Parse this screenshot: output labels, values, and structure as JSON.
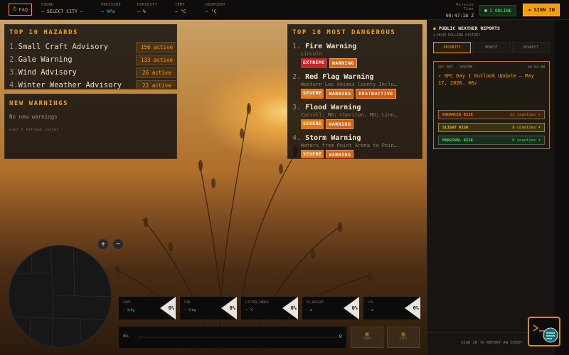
{
  "topbar": {
    "faq_label": "FAQ",
    "faq_icon": "clock-icon",
    "fields": [
      {
        "label": "COORD",
        "value": "— SELECT CITY —",
        "unit": ""
      },
      {
        "label": "PRESSURE",
        "value": "—",
        "unit": "hPa"
      },
      {
        "label": "HUMIDITY",
        "value": "—",
        "unit": "%"
      },
      {
        "label": "TEMP",
        "value": "—",
        "unit": "°C"
      },
      {
        "label": "DEWPOINT",
        "value": "—",
        "unit": "°C"
      }
    ],
    "mission_time_label": "Mission Time",
    "mission_time": "09:47:18 Z",
    "online_label": "1 ONLINE",
    "signin_label": "SIGN IN",
    "signin_icon": "login-icon"
  },
  "hazards": {
    "title": "TOP 10 HAZARDS",
    "items": [
      {
        "num": "1.",
        "name": "Small Craft Advisory",
        "badge": "156 active"
      },
      {
        "num": "2.",
        "name": "Gale Warning",
        "badge": "133 active"
      },
      {
        "num": "3.",
        "name": "Wind Advisory",
        "badge": "26 active"
      },
      {
        "num": "4.",
        "name": "Winter Weather Advisory",
        "badge": "22 active"
      }
    ]
  },
  "new_warnings": {
    "title": "NEW WARNINGS",
    "message": "No new warnings",
    "footnote": "Last 5 refresh cycles"
  },
  "dangerous": {
    "title": "TOP 10 MOST DANGEROUS",
    "items": [
      {
        "num": "1.",
        "name": "Fire Warning",
        "loc": "Lincoln",
        "tags": [
          "EXTREME",
          "WARNING"
        ]
      },
      {
        "num": "2.",
        "name": "Red Flag Warning",
        "loc": "Western Las Animas County Inclu…",
        "tags": [
          "SEVERE",
          "WARNING",
          "DESTRUCTIVE"
        ]
      },
      {
        "num": "3.",
        "name": "Flood Warning",
        "loc": "Carroll, MO; Chariton, MO; Linn…",
        "tags": [
          "SEVERE",
          "WARNING"
        ]
      },
      {
        "num": "4.",
        "name": "Storm Warning",
        "loc": "Waters from Point Arena to Poin…",
        "tags": [
          "SEVERE",
          "WARNING"
        ]
      }
    ]
  },
  "reports": {
    "title": "PUBLIC WEATHER REPORTS",
    "subtitle": "2-HOUR ROLLING HISTORY",
    "tabs": [
      "PRIORITY",
      "NEWEST",
      "NEAREST"
    ],
    "card": {
      "source": "SPC BOT · SYSTEM",
      "time": "06:54 AM",
      "text": "⚡ SPC Day 1 Outlook Update — May 17, 2026. 06z",
      "risks": [
        {
          "label": "ENHANCED RISK",
          "count": "12 counties ▾",
          "color": "#e0781c",
          "bg": "#3a2410"
        },
        {
          "label": "SLIGHT RISK",
          "count": "8 counties ▾",
          "color": "#e8c020",
          "bg": "#3a3210"
        },
        {
          "label": "MARGINAL RISK",
          "count": "6 counties ▾",
          "color": "#4ade80",
          "bg": "#16301c"
        }
      ]
    },
    "footer": "SIGN IN TO REPORT AN EVENT"
  },
  "map": {
    "zoom_in": "+",
    "zoom_out": "−"
  },
  "metrics": [
    {
      "label": "CAPE",
      "value": "— J/kg",
      "pct": "0%"
    },
    {
      "label": "CIN",
      "value": "— J/kg",
      "pct": "0%"
    },
    {
      "label": "LIFTED_INDEX",
      "value": "— °C",
      "pct": "0%"
    },
    {
      "label": "0C_HEIGHT",
      "value": "— m",
      "pct": "0%"
    },
    {
      "label": "LCL",
      "value": "— m",
      "pct": "0%"
    }
  ],
  "mrl": {
    "label": "MRL",
    "value": "0"
  },
  "buttons": [
    {
      "label": "SHOW",
      "icon": "panel-icon"
    },
    {
      "label": "HIDE",
      "icon": "panel-icon"
    }
  ],
  "colors": {
    "accent": "#f59e0b",
    "online": "#4ade80"
  }
}
